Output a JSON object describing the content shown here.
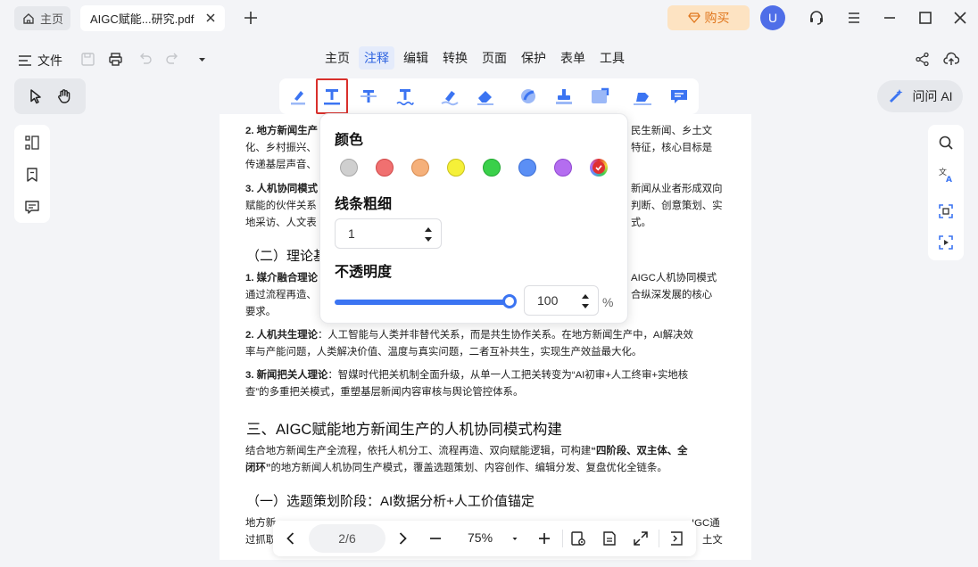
{
  "titlebar": {
    "home_tab": "主页",
    "doc_tab": "AIGC赋能...研究.pdf",
    "buy_label": "购买",
    "avatar_letter": "U"
  },
  "menubar": {
    "file_label": "文件",
    "tabs": [
      {
        "label": "主页"
      },
      {
        "label": "注释"
      },
      {
        "label": "编辑"
      },
      {
        "label": "转换"
      },
      {
        "label": "页面"
      },
      {
        "label": "保护"
      },
      {
        "label": "表单"
      },
      {
        "label": "工具"
      }
    ],
    "active_tab": "注释"
  },
  "ask_ai": "问问 AI",
  "popover": {
    "color_label": "颜色",
    "colors": [
      "#cfcfcf",
      "#f07070",
      "#f5b07a",
      "#f5f038",
      "#3ad04a",
      "#5b8ff5",
      "#b46df0",
      "#e03030"
    ],
    "line_label": "线条粗细",
    "line_value": "1",
    "opacity_label": "不透明度",
    "opacity_value": "100",
    "opacity_unit": "%"
  },
  "document": {
    "p1a_bold": "2. 地方新闻生产",
    "p1a_rest": "民生新闻、乡土文",
    "p1b_left": "化、乡村振兴、",
    "p1b_right": "特征，核心目标是",
    "p1c": "传递基层声音、",
    "p2a_bold": "3. 人机协同模式",
    "p2a_rest": "新闻从业者形成双向",
    "p2b_left": "赋能的伙伴关系",
    "p2b_right": "判断、创意策划、实",
    "p2c_left": "地采访、人文表",
    "p2c_right": "式。",
    "h_theory": "（二）理论基",
    "p3a_bold": "1. 媒介融合理论",
    "p3a_rest": "AIGC人机协同模式",
    "p3b_left": "通过流程再造、",
    "p3b_right": "合纵深发展的核心",
    "p3c": "要求。",
    "p4a_bold": "2. 人机共生理论",
    "p4a_rest": "：人工智能与人类并非替代关系，而是共生协作关系。在地方新闻生产中，AI解决效",
    "p4b": "率与产能问题，人类解决价值、温度与真实问题，二者互补共生，实现生产效益最大化。",
    "p5a_bold": "3. 新闻把关人理论",
    "p5a_rest": "：智媒时代把关机制全面升级，从单一人工把关转变为“AI初审+人工终审+实地核",
    "p5b": "查”的多重把关模式，重塑基层新闻内容审核与舆论管控体系。",
    "h3": "三、AIGC赋能地方新闻生产的人机协同模式构建",
    "p6a_pre": "结合地方新闻生产全流程，依托人机分工、流程再造、双向赋能逻辑，可构建",
    "p6a_bold": "“四阶段、双主体、全",
    "p6b_bold": "闭环”",
    "p6b_rest": "的地方新闻人机协同生产模式，覆盖选题策划、内容创作、编辑分发、复盘优化全链条。",
    "h_stage1": "（一）选题策划阶段：AI数据分析+人工价值锚定",
    "p7a_left": "地方新",
    "p7a_right": "IGC通",
    "p7b_left": "过抓取",
    "p7b_right": "土文"
  },
  "bottombar": {
    "page": "2/6",
    "zoom": "75%"
  }
}
